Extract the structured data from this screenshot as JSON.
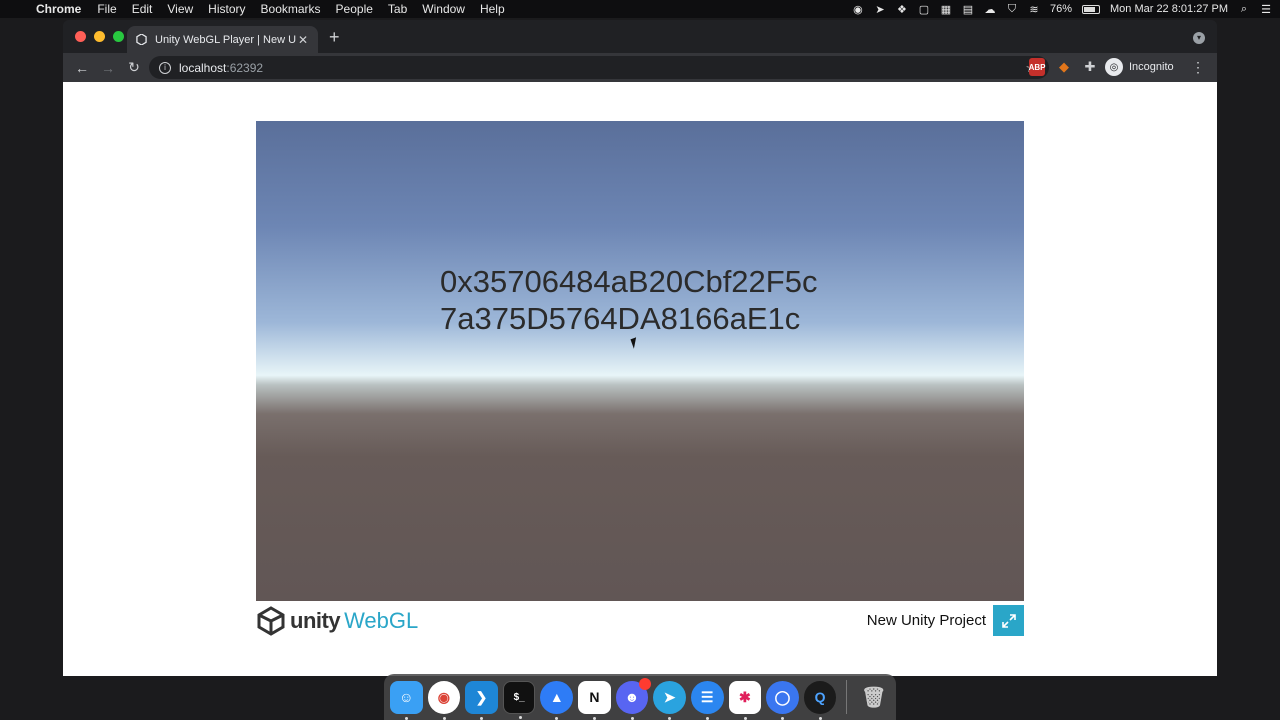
{
  "menubar": {
    "app": "Chrome",
    "items": [
      "File",
      "Edit",
      "View",
      "History",
      "Bookmarks",
      "People",
      "Tab",
      "Window",
      "Help"
    ],
    "battery": "76%",
    "battery_level": 0.76,
    "datetime": "Mon Mar 22  8:01:27 PM"
  },
  "browser": {
    "tab_title": "Unity WebGL Player | New Unity Project",
    "url_host": "localhost",
    "url_port": ":62392",
    "profile_label": "Incognito",
    "extension_abp": "ABP"
  },
  "page": {
    "canvas_text_line1": "0x35706484aB20Cbf22F5c",
    "canvas_text_line2": "7a375D5764DA8166aE1c",
    "logo_word1": "unity",
    "logo_word2": "WebGL",
    "project_title": "New Unity Project"
  },
  "dock": {
    "apps": [
      "Finder",
      "Chrome",
      "VS Code",
      "Terminal",
      "Arc",
      "Notion",
      "Discord",
      "Telegram",
      "Messages",
      "Slack",
      "Signal",
      "QuickTime",
      "Trash"
    ],
    "colors": {
      "finder": "#3aa0f4",
      "chrome": "#ffffff",
      "vscode": "#1e86d6",
      "terminal": "#111111",
      "arc": "#2e7cf6",
      "notion": "#ffffff",
      "discord": "#5865f2",
      "telegram": "#2aa3df",
      "messages": "#2b86f0",
      "slack": "#ffffff",
      "signal": "#3a76f0",
      "quicktime": "#1b1b1b",
      "trash": "#bbbbbb"
    }
  }
}
